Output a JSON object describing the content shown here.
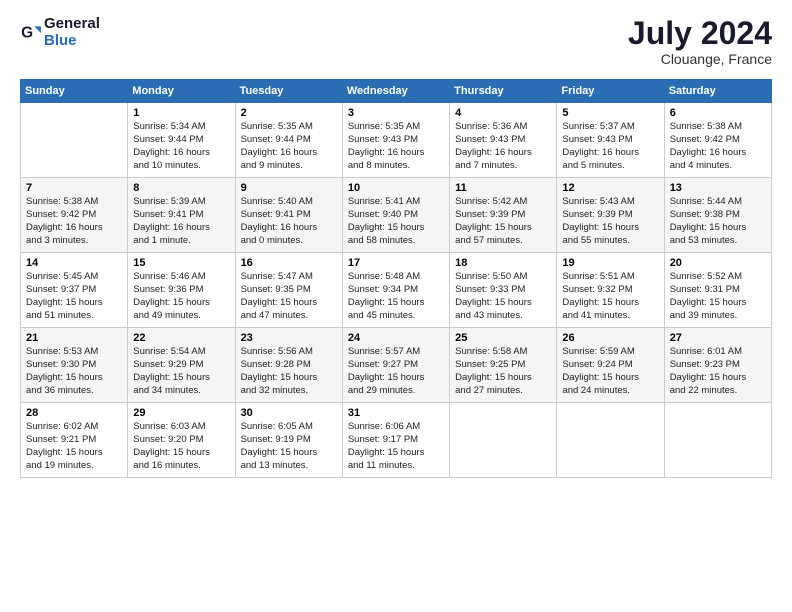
{
  "header": {
    "logo_general": "General",
    "logo_blue": "Blue",
    "month_year": "July 2024",
    "location": "Clouange, France"
  },
  "weekdays": [
    "Sunday",
    "Monday",
    "Tuesday",
    "Wednesday",
    "Thursday",
    "Friday",
    "Saturday"
  ],
  "weeks": [
    [
      {
        "day": "",
        "info": ""
      },
      {
        "day": "1",
        "info": "Sunrise: 5:34 AM\nSunset: 9:44 PM\nDaylight: 16 hours\nand 10 minutes."
      },
      {
        "day": "2",
        "info": "Sunrise: 5:35 AM\nSunset: 9:44 PM\nDaylight: 16 hours\nand 9 minutes."
      },
      {
        "day": "3",
        "info": "Sunrise: 5:35 AM\nSunset: 9:43 PM\nDaylight: 16 hours\nand 8 minutes."
      },
      {
        "day": "4",
        "info": "Sunrise: 5:36 AM\nSunset: 9:43 PM\nDaylight: 16 hours\nand 7 minutes."
      },
      {
        "day": "5",
        "info": "Sunrise: 5:37 AM\nSunset: 9:43 PM\nDaylight: 16 hours\nand 5 minutes."
      },
      {
        "day": "6",
        "info": "Sunrise: 5:38 AM\nSunset: 9:42 PM\nDaylight: 16 hours\nand 4 minutes."
      }
    ],
    [
      {
        "day": "7",
        "info": "Sunrise: 5:38 AM\nSunset: 9:42 PM\nDaylight: 16 hours\nand 3 minutes."
      },
      {
        "day": "8",
        "info": "Sunrise: 5:39 AM\nSunset: 9:41 PM\nDaylight: 16 hours\nand 1 minute."
      },
      {
        "day": "9",
        "info": "Sunrise: 5:40 AM\nSunset: 9:41 PM\nDaylight: 16 hours\nand 0 minutes."
      },
      {
        "day": "10",
        "info": "Sunrise: 5:41 AM\nSunset: 9:40 PM\nDaylight: 15 hours\nand 58 minutes."
      },
      {
        "day": "11",
        "info": "Sunrise: 5:42 AM\nSunset: 9:39 PM\nDaylight: 15 hours\nand 57 minutes."
      },
      {
        "day": "12",
        "info": "Sunrise: 5:43 AM\nSunset: 9:39 PM\nDaylight: 15 hours\nand 55 minutes."
      },
      {
        "day": "13",
        "info": "Sunrise: 5:44 AM\nSunset: 9:38 PM\nDaylight: 15 hours\nand 53 minutes."
      }
    ],
    [
      {
        "day": "14",
        "info": "Sunrise: 5:45 AM\nSunset: 9:37 PM\nDaylight: 15 hours\nand 51 minutes."
      },
      {
        "day": "15",
        "info": "Sunrise: 5:46 AM\nSunset: 9:36 PM\nDaylight: 15 hours\nand 49 minutes."
      },
      {
        "day": "16",
        "info": "Sunrise: 5:47 AM\nSunset: 9:35 PM\nDaylight: 15 hours\nand 47 minutes."
      },
      {
        "day": "17",
        "info": "Sunrise: 5:48 AM\nSunset: 9:34 PM\nDaylight: 15 hours\nand 45 minutes."
      },
      {
        "day": "18",
        "info": "Sunrise: 5:50 AM\nSunset: 9:33 PM\nDaylight: 15 hours\nand 43 minutes."
      },
      {
        "day": "19",
        "info": "Sunrise: 5:51 AM\nSunset: 9:32 PM\nDaylight: 15 hours\nand 41 minutes."
      },
      {
        "day": "20",
        "info": "Sunrise: 5:52 AM\nSunset: 9:31 PM\nDaylight: 15 hours\nand 39 minutes."
      }
    ],
    [
      {
        "day": "21",
        "info": "Sunrise: 5:53 AM\nSunset: 9:30 PM\nDaylight: 15 hours\nand 36 minutes."
      },
      {
        "day": "22",
        "info": "Sunrise: 5:54 AM\nSunset: 9:29 PM\nDaylight: 15 hours\nand 34 minutes."
      },
      {
        "day": "23",
        "info": "Sunrise: 5:56 AM\nSunset: 9:28 PM\nDaylight: 15 hours\nand 32 minutes."
      },
      {
        "day": "24",
        "info": "Sunrise: 5:57 AM\nSunset: 9:27 PM\nDaylight: 15 hours\nand 29 minutes."
      },
      {
        "day": "25",
        "info": "Sunrise: 5:58 AM\nSunset: 9:25 PM\nDaylight: 15 hours\nand 27 minutes."
      },
      {
        "day": "26",
        "info": "Sunrise: 5:59 AM\nSunset: 9:24 PM\nDaylight: 15 hours\nand 24 minutes."
      },
      {
        "day": "27",
        "info": "Sunrise: 6:01 AM\nSunset: 9:23 PM\nDaylight: 15 hours\nand 22 minutes."
      }
    ],
    [
      {
        "day": "28",
        "info": "Sunrise: 6:02 AM\nSunset: 9:21 PM\nDaylight: 15 hours\nand 19 minutes."
      },
      {
        "day": "29",
        "info": "Sunrise: 6:03 AM\nSunset: 9:20 PM\nDaylight: 15 hours\nand 16 minutes."
      },
      {
        "day": "30",
        "info": "Sunrise: 6:05 AM\nSunset: 9:19 PM\nDaylight: 15 hours\nand 13 minutes."
      },
      {
        "day": "31",
        "info": "Sunrise: 6:06 AM\nSunset: 9:17 PM\nDaylight: 15 hours\nand 11 minutes."
      },
      {
        "day": "",
        "info": ""
      },
      {
        "day": "",
        "info": ""
      },
      {
        "day": "",
        "info": ""
      }
    ]
  ]
}
